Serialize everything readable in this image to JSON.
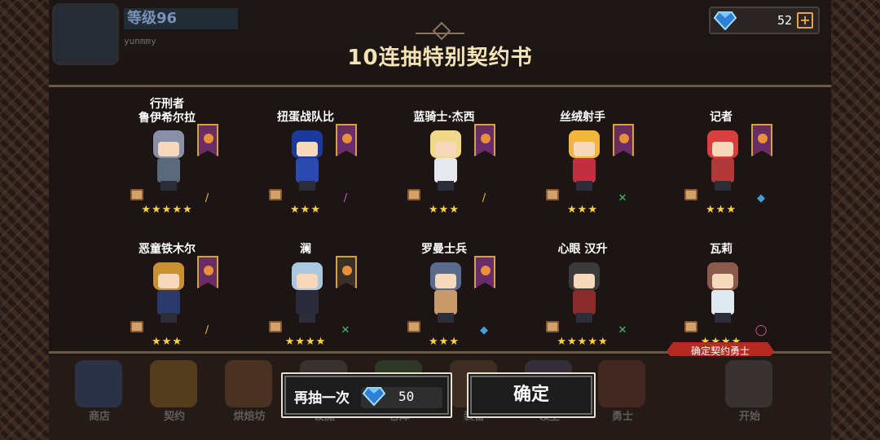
{
  "hud": {
    "level_text": "等级96",
    "username": "yunmmy",
    "gems": "52",
    "plus": "+"
  },
  "panel": {
    "title": "10连抽特别契约书",
    "confirm_tag": "确定契约勇士"
  },
  "heroes": [
    {
      "name": "行刑者\n鲁伊希尔拉",
      "stars": "★★★★★",
      "hair": "#8a8fa8",
      "outfit": "#5a6a7a",
      "banner": "purple",
      "weapon": "gold-wand"
    },
    {
      "name": "扭蛋战队比",
      "stars": "★★★",
      "hair": "#1a3a9a",
      "outfit": "#2a4ab0",
      "banner": "purple",
      "weapon": "purple-wand"
    },
    {
      "name": "蓝骑士·杰西",
      "stars": "★★★",
      "hair": "#f2d88a",
      "outfit": "#e8e8f0",
      "banner": "purple",
      "weapon": "gold-wand"
    },
    {
      "name": "丝绒射手",
      "stars": "★★★",
      "hair": "#f2b63a",
      "outfit": "#c03040",
      "banner": "purple",
      "weapon": "green-bow"
    },
    {
      "name": "记者",
      "stars": "★★★",
      "hair": "#d84040",
      "outfit": "#b03a3a",
      "banner": "purple",
      "weapon": "blue-axe"
    },
    {
      "name": "恶童铁木尔",
      "stars": "★★★",
      "hair": "#c89030",
      "outfit": "#2a3a6a",
      "banner": "purple",
      "weapon": "gold-wand"
    },
    {
      "name": "澜",
      "stars": "★★★★",
      "hair": "#a8c8e0",
      "outfit": "#2a2a3a",
      "banner": "gold",
      "weapon": "green-bow"
    },
    {
      "name": "罗曼士兵",
      "stars": "★★★",
      "hair": "#5a6a8a",
      "outfit": "#c89a6a",
      "banner": "purple",
      "weapon": "blue-axe"
    },
    {
      "name": "心眼 汉升",
      "stars": "★★★★★",
      "hair": "#3a3a3a",
      "outfit": "#8a2a2a",
      "banner": "none",
      "weapon": "green-bow"
    },
    {
      "name": "瓦莉",
      "stars": "★★★★",
      "hair": "#8a5a4a",
      "outfit": "#e0e8f0",
      "banner": "none",
      "weapon": "pink-ring"
    }
  ],
  "bottom_nav": [
    "商店",
    "契约",
    "烘焙坊",
    "设施",
    "仓库",
    "装备",
    "领主",
    "勇士",
    "开始"
  ],
  "actions": {
    "redraw_label": "再抽一次",
    "redraw_cost": "50",
    "confirm_label": "确定"
  },
  "colors": {
    "star": "#ffd23a",
    "title": "#f4e3b4",
    "tag_red": "#b52a22"
  }
}
